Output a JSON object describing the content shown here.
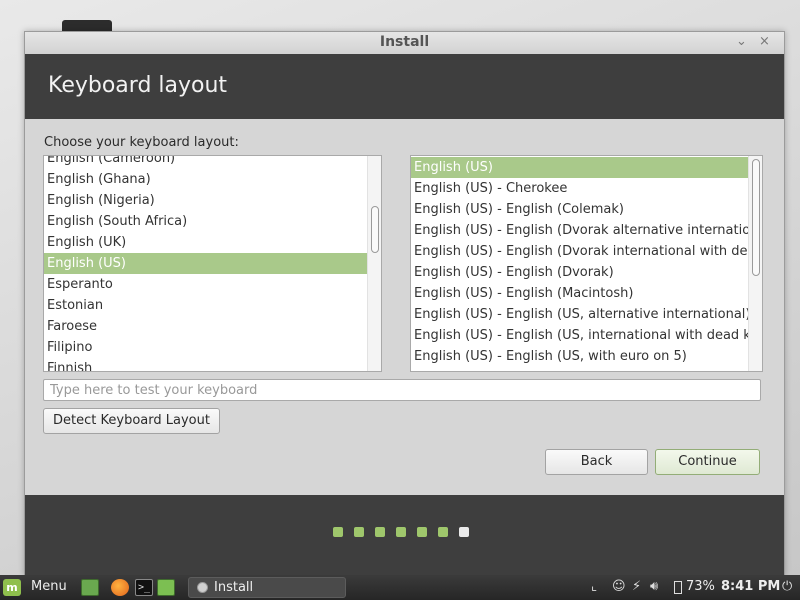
{
  "window": {
    "title": "Install",
    "minimize_glyph": "⌄",
    "close_glyph": "×"
  },
  "header": {
    "title": "Keyboard layout"
  },
  "prompt": "Choose your keyboard layout:",
  "layouts": [
    {
      "label": "English (Cameroon)",
      "selected": false
    },
    {
      "label": "English (Ghana)",
      "selected": false
    },
    {
      "label": "English (Nigeria)",
      "selected": false
    },
    {
      "label": "English (South Africa)",
      "selected": false
    },
    {
      "label": "English (UK)",
      "selected": false
    },
    {
      "label": "English (US)",
      "selected": true
    },
    {
      "label": "Esperanto",
      "selected": false
    },
    {
      "label": "Estonian",
      "selected": false
    },
    {
      "label": "Faroese",
      "selected": false
    },
    {
      "label": "Filipino",
      "selected": false
    },
    {
      "label": "Finnish",
      "selected": false
    }
  ],
  "variants": [
    {
      "label": "English (US)",
      "selected": true
    },
    {
      "label": "English (US) - Cherokee",
      "selected": false
    },
    {
      "label": "English (US) - English (Colemak)",
      "selected": false
    },
    {
      "label": "English (US) - English (Dvorak alternative international",
      "selected": false
    },
    {
      "label": "English (US) - English (Dvorak international with dead k",
      "selected": false
    },
    {
      "label": "English (US) - English (Dvorak)",
      "selected": false
    },
    {
      "label": "English (US) - English (Macintosh)",
      "selected": false
    },
    {
      "label": "English (US) - English (US, alternative international)",
      "selected": false
    },
    {
      "label": "English (US) - English (US, international with dead keys",
      "selected": false
    },
    {
      "label": "English (US) - English (US, with euro on 5)",
      "selected": false
    }
  ],
  "test_input": {
    "placeholder": "Type here to test your keyboard",
    "value": ""
  },
  "buttons": {
    "detect": "Detect Keyboard Layout",
    "back": "Back",
    "continue": "Continue"
  },
  "progress": {
    "total_steps": 7,
    "current_step": 7,
    "accent": "#9fc76c"
  },
  "colors": {
    "selection": "#a9c98a",
    "header_bg": "#3e3e3e"
  },
  "taskbar": {
    "menu_label": "Menu",
    "task_label": "Install",
    "battery": "73%",
    "clock": "8:41 PM",
    "icons": [
      "mint-logo-icon",
      "files-icon",
      "firefox-icon",
      "terminal-icon",
      "folder-icon",
      "disc-icon",
      "user-icon",
      "network-icon",
      "volume-icon",
      "battery-icon",
      "power-icon"
    ]
  }
}
